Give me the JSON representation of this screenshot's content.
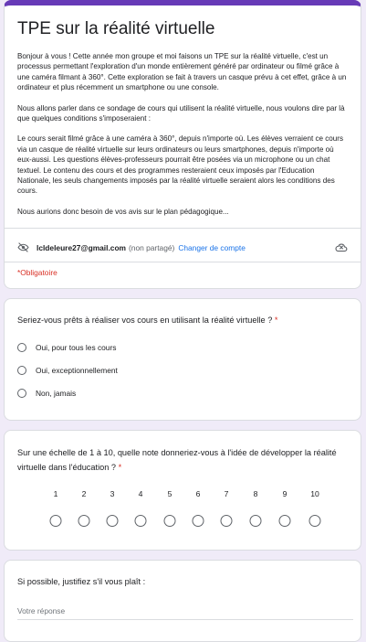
{
  "form": {
    "title": "TPE sur la réalité virtuelle",
    "description": [
      "Bonjour à vous ! Cette année mon groupe et moi faisons un TPE sur la réalité virtuelle, c'est un processus permettant l'exploration d'un monde entièrement généré par ordinateur ou filmé grâce à une caméra filmant à 360°. Cette exploration se fait à travers un casque prévu à cet effet, grâce à un ordinateur et plus récemment un smartphone ou une console.",
      "Nous allons parler dans ce sondage de cours qui utilisent la réalité virtuelle, nous voulons dire par là que quelques conditions s'imposeraient :",
      "Le cours serait filmé grâce à une caméra à 360°, depuis n'importe où. Les élèves verraient ce cours via un casque de réalité virtuelle sur leurs ordinateurs ou leurs smartphones, depuis n'importe où eux-aussi. Les questions élèves-professeurs pourrait être posées via un microphone ou un chat textuel. Le contenu des cours et des programmes resteraient ceux imposés par l'Education Nationale, les seuls changements imposés par la réalité virtuelle seraient alors les conditions des cours.",
      "Nous aurions donc besoin de vos avis sur le plan pédagogique..."
    ],
    "account_email": "lcldeleure27@gmail.com",
    "account_shared": "(non partagé)",
    "switch_account": "Changer de compte",
    "required_note": "*Obligatoire"
  },
  "questions": {
    "q1": {
      "title": "Seriez-vous prêts à réaliser vos cours en utilisant la réalité virtuelle ?",
      "required_mark": "*",
      "options": [
        "Oui, pour tous les cours",
        "Oui, exceptionnellement",
        "Non, jamais"
      ]
    },
    "q2": {
      "title": "Sur une échelle de 1 à 10, quelle note donneriez-vous à l'idée de développer la réalité virtuelle dans l'éducation ?",
      "required_mark": "*",
      "scale": [
        "1",
        "2",
        "3",
        "4",
        "5",
        "6",
        "7",
        "8",
        "9",
        "10"
      ]
    },
    "q3": {
      "title": "Si possible, justifiez s'il vous plaît :",
      "placeholder": "Votre réponse"
    }
  },
  "colors": {
    "accent": "#673ab7",
    "background": "#f0ebf8",
    "required": "#d93025",
    "link": "#1a73e8"
  },
  "icons": {
    "account": "eye-off-icon",
    "cloud": "cloud-off-icon"
  }
}
